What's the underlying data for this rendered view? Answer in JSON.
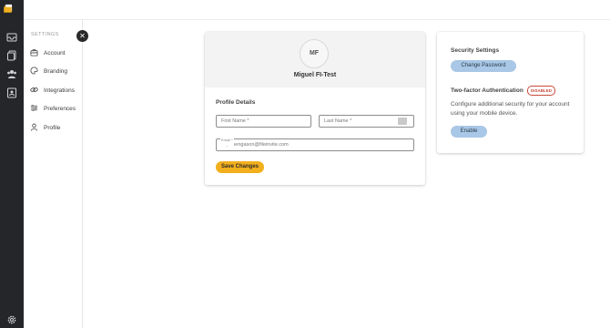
{
  "sidebar": {
    "title": "SETTINGS",
    "items": [
      {
        "label": "Account",
        "icon": "briefcase-icon"
      },
      {
        "label": "Branding",
        "icon": "palette-icon"
      },
      {
        "label": "Integrations",
        "icon": "link-icon"
      },
      {
        "label": "Preferences",
        "icon": "sliders-icon"
      },
      {
        "label": "Profile",
        "icon": "user-icon"
      }
    ]
  },
  "profile": {
    "initials": "MF",
    "name": "Miguel FI-Test",
    "section_title": "Profile Details",
    "first_name_placeholder": "First Name *",
    "last_name_placeholder": "Last Name *",
    "email_label": "Email *",
    "email_value": "m.panengason@fileinvite.com",
    "save_label": "Save Changes"
  },
  "security": {
    "title": "Security Settings",
    "change_password_label": "Change Password",
    "twofa_title": "Two-factor Authentication",
    "twofa_status": "DISABLED",
    "description": "Configure additional security for your account using your mobile device.",
    "enable_label": "Enable"
  },
  "colors": {
    "rail": "#25262a",
    "accent_yellow": "#f2b01e",
    "accent_blue": "#a9c7e6",
    "badge_red": "#c94a3d"
  }
}
